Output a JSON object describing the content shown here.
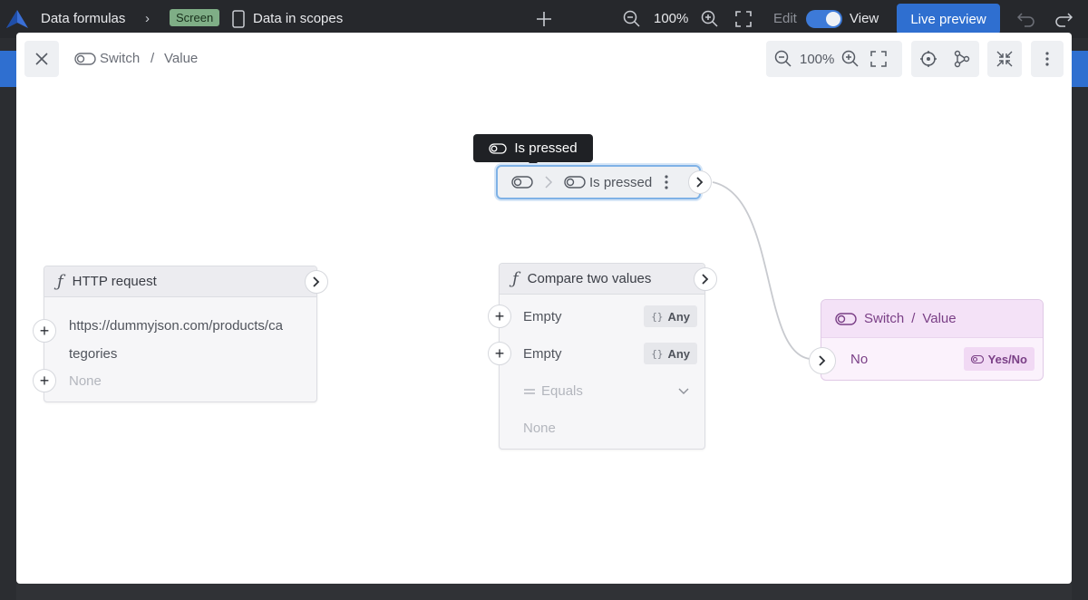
{
  "topbar": {
    "app_name": "Data formulas",
    "screen_badge": "Screen",
    "page_name": "Data in scopes",
    "zoom": "100%",
    "edit_label": "Edit",
    "view_label": "View",
    "live_preview_label": "Live preview"
  },
  "modal": {
    "breadcrumb": {
      "parent": "Switch",
      "separator": "/",
      "current": "Value"
    },
    "zoom": "100%"
  },
  "canvas": {
    "tooltip": "Is pressed",
    "pressed_node": {
      "label": "Is pressed"
    },
    "http_node": {
      "title": "HTTP request",
      "url_line1": "https://dummyjson.com/products/ca",
      "url_line2": "tegories",
      "none_label": "None"
    },
    "compare_node": {
      "title": "Compare two values",
      "input1": "Empty",
      "input1_type": "Any",
      "input2": "Empty",
      "input2_type": "Any",
      "operator": "Equals",
      "none_label": "None"
    },
    "switch_node": {
      "title_parent": "Switch",
      "title_sep": "/",
      "title_current": "Value",
      "value": "No",
      "type": "Yes/No"
    }
  }
}
